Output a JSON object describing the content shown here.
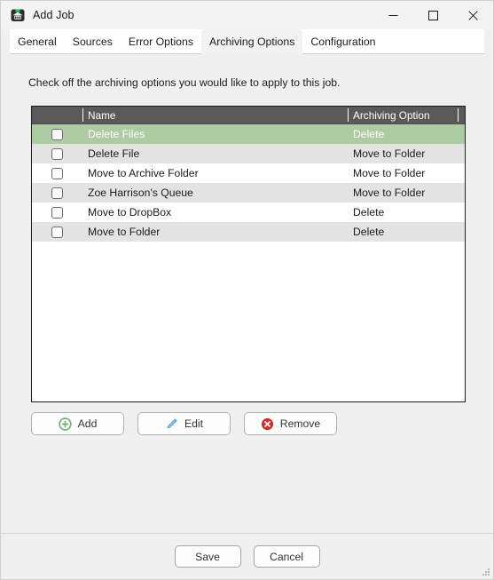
{
  "window": {
    "title": "Add Job",
    "icon": "app-icon",
    "controls": {
      "minimize": "minimize-icon",
      "maximize": "maximize-icon",
      "close": "close-icon"
    }
  },
  "tabs": [
    {
      "label": "General",
      "active": false
    },
    {
      "label": "Sources",
      "active": false
    },
    {
      "label": "Error Options",
      "active": false
    },
    {
      "label": "Archiving Options",
      "active": true
    },
    {
      "label": "Configuration",
      "active": false
    }
  ],
  "page": {
    "instruction": "Check off the archiving options you would like to apply to this job."
  },
  "list": {
    "columns": [
      {
        "key": "check",
        "label": ""
      },
      {
        "key": "name",
        "label": "Name"
      },
      {
        "key": "option",
        "label": "Archiving Option"
      }
    ],
    "rows": [
      {
        "name": "Delete Files",
        "option": "Delete",
        "checked": false,
        "selected": true
      },
      {
        "name": "Delete File",
        "option": "Move to Folder",
        "checked": false,
        "selected": false
      },
      {
        "name": "Move to Archive Folder",
        "option": "Move to Folder",
        "checked": false,
        "selected": false
      },
      {
        "name": "Zoe Harrison's Queue",
        "option": "Move to Folder",
        "checked": false,
        "selected": false
      },
      {
        "name": "Move to DropBox",
        "option": "Delete",
        "checked": false,
        "selected": false
      },
      {
        "name": "Move to Folder",
        "option": "Delete",
        "checked": false,
        "selected": false
      }
    ]
  },
  "actions": {
    "add": {
      "label": "Add",
      "icon": "plus-circle-icon",
      "color": "#6cb06c"
    },
    "edit": {
      "label": "Edit",
      "icon": "pencil-icon",
      "color": "#5aa7de"
    },
    "remove": {
      "label": "Remove",
      "icon": "remove-circle-icon",
      "color": "#d82b2b"
    }
  },
  "footer": {
    "save": "Save",
    "cancel": "Cancel"
  },
  "colors": {
    "header_bar": "#595959",
    "selected_row": "#aecca4",
    "alt_row": "#e3e3e3",
    "window_bg": "#f0f0f0"
  }
}
